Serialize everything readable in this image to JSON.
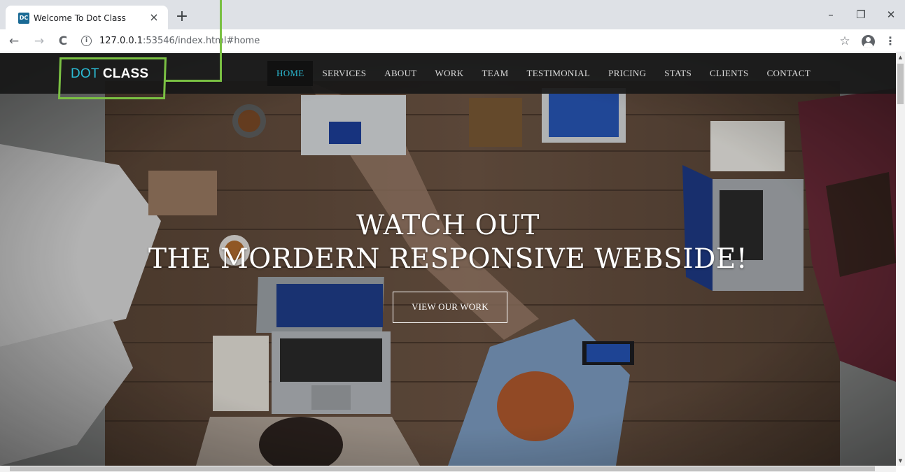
{
  "browser": {
    "tab": {
      "favicon": "DC",
      "title": "Welcome To Dot Class",
      "close": "×"
    },
    "new_tab": "+",
    "window_controls": {
      "minimize": "–",
      "restore": "❐",
      "close": "✕"
    },
    "nav_buttons": {
      "back": "←",
      "forward": "→",
      "reload": "C"
    },
    "address": {
      "info": "i",
      "host": "127.0.0.1",
      "rest": ":53546/index.html#home"
    },
    "star": "☆",
    "menu": "⋮"
  },
  "site": {
    "logo": {
      "part1": "DOT",
      "part2": "CLASS"
    },
    "nav": [
      {
        "label": "HOME",
        "active": true
      },
      {
        "label": "SERVICES",
        "active": false
      },
      {
        "label": "ABOUT",
        "active": false
      },
      {
        "label": "WORK",
        "active": false
      },
      {
        "label": "TEAM",
        "active": false
      },
      {
        "label": "TESTIMONIAL",
        "active": false
      },
      {
        "label": "PRICING",
        "active": false
      },
      {
        "label": "STATS",
        "active": false
      },
      {
        "label": "CLIENTS",
        "active": false
      },
      {
        "label": "CONTACT",
        "active": false
      }
    ],
    "hero": {
      "line1": "WATCH OUT",
      "line2": "THE MORDERN RESPONSIVE WEBSIDE!",
      "cta": "VIEW OUR WORK"
    }
  },
  "icons": {
    "favicon": "dc-favicon-icon",
    "info": "info-icon",
    "star": "star-icon",
    "profile": "profile-icon",
    "menu": "kebab-menu-icon"
  },
  "colors": {
    "accent": "#2bbbd4",
    "annotation": "#7ac043",
    "navbar": "#181818",
    "tabstrip": "#dee1e6"
  }
}
